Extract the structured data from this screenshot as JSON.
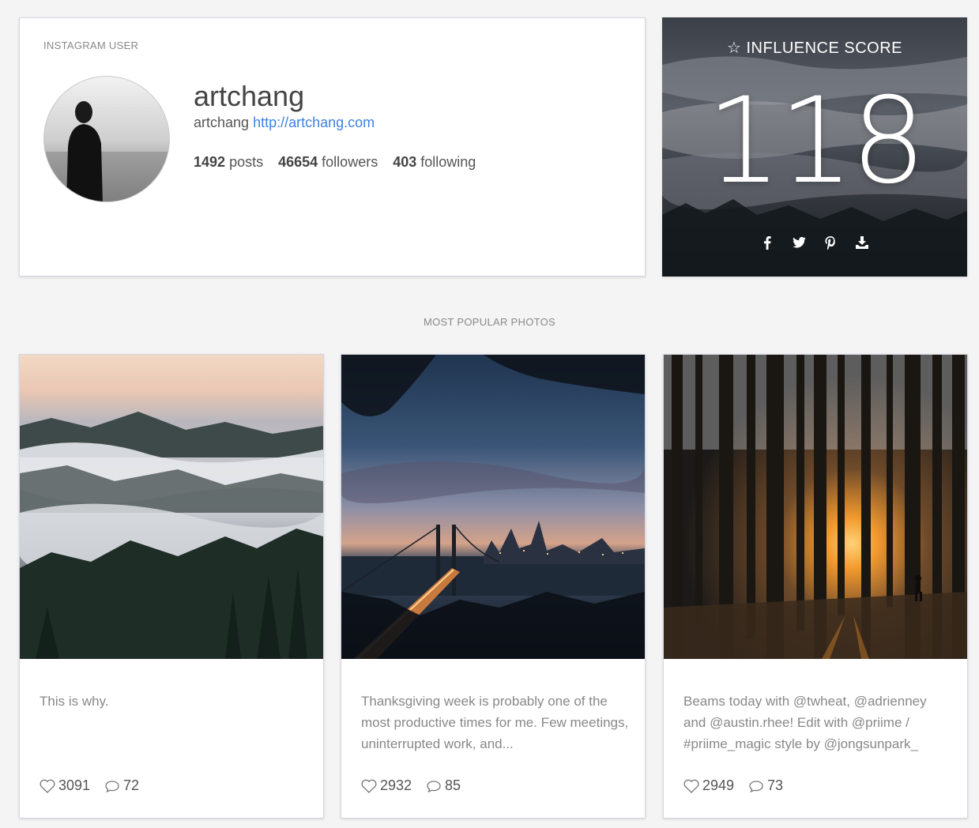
{
  "profile": {
    "label": "INSTAGRAM USER",
    "username": "artchang",
    "bio_name": "artchang",
    "website": "http://artchang.com",
    "stats": {
      "posts_count": "1492",
      "posts_label": "posts",
      "followers_count": "46654",
      "followers_label": "followers",
      "following_count": "403",
      "following_label": "following"
    }
  },
  "score": {
    "title": "INFLUENCE SCORE",
    "value": "118",
    "share_icons": [
      "facebook-icon",
      "twitter-icon",
      "pinterest-icon",
      "download-icon"
    ]
  },
  "popular": {
    "label": "MOST POPULAR PHOTOS",
    "photos": [
      {
        "caption": "This is why.",
        "likes": "3091",
        "comments": "72"
      },
      {
        "caption": "Thanksgiving week is probably one of the most productive times for me. Few meetings, uninterrupted work, and...",
        "likes": "2932",
        "comments": "85"
      },
      {
        "caption": "Beams today with @twheat, @adrienney and @austin.rhee! Edit with @priime / #priime_magic style by @jongsunpark_",
        "likes": "2949",
        "comments": "73"
      }
    ]
  },
  "colors": {
    "link": "#3d82e0",
    "background": "#f4f4f5"
  }
}
